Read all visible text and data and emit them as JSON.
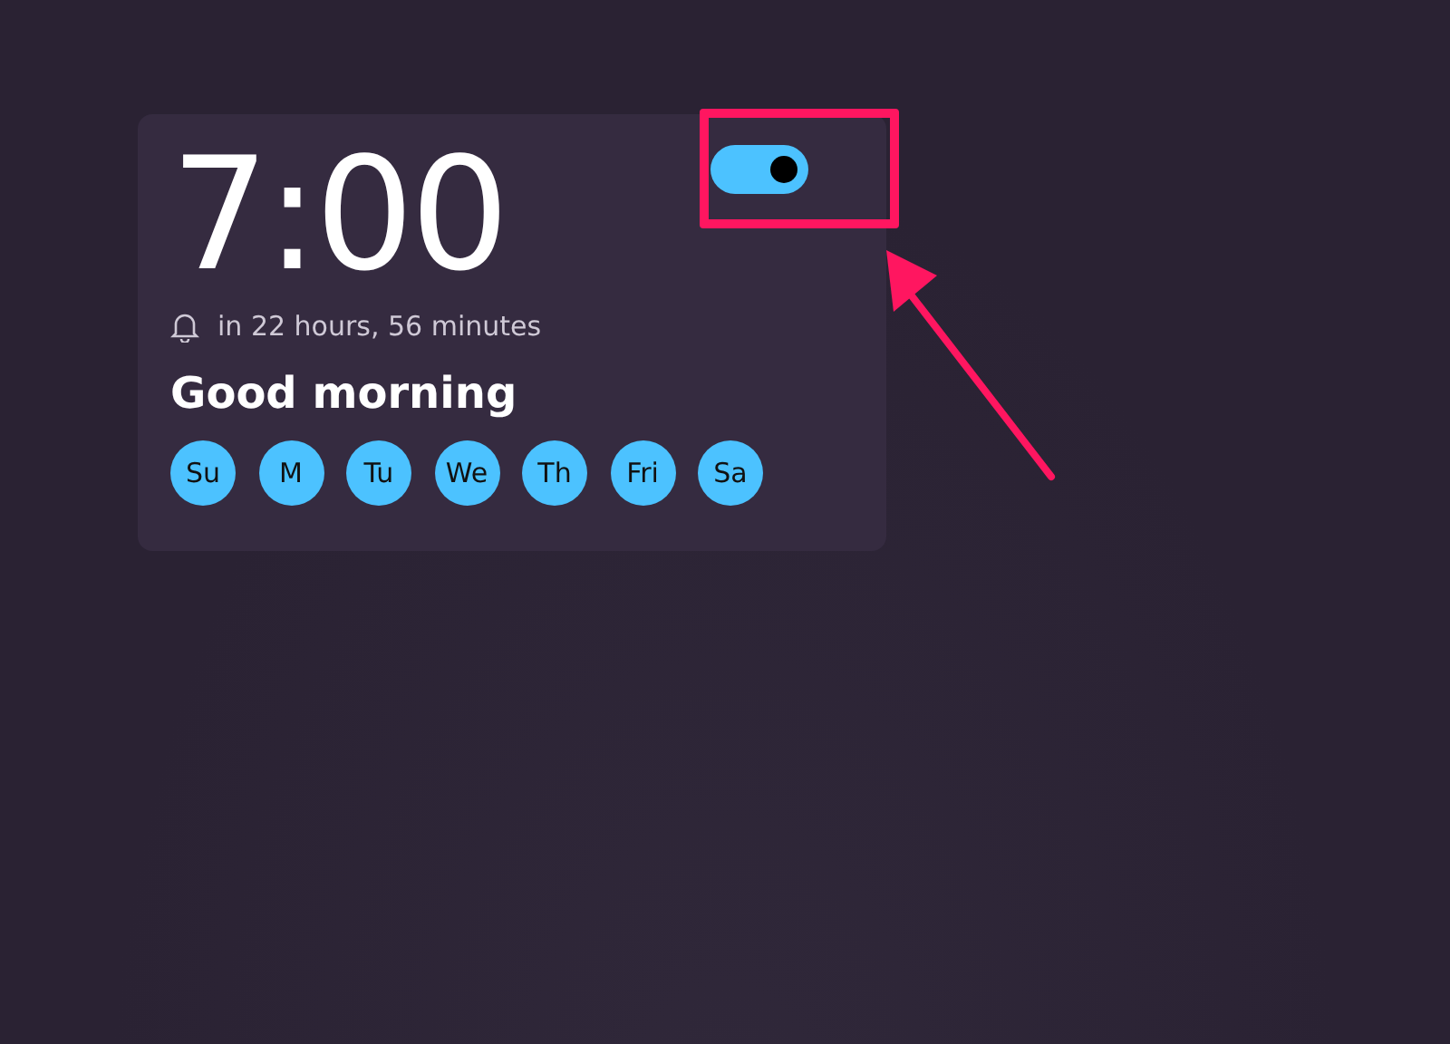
{
  "alarm": {
    "time": "7:00",
    "on": true,
    "countdown": "in 22 hours, 56 minutes",
    "name": "Good morning",
    "days": [
      {
        "label": "Su",
        "selected": true
      },
      {
        "label": "M",
        "selected": true
      },
      {
        "label": "Tu",
        "selected": true
      },
      {
        "label": "We",
        "selected": true
      },
      {
        "label": "Th",
        "selected": true
      },
      {
        "label": "Fri",
        "selected": true
      },
      {
        "label": "Sa",
        "selected": true
      }
    ]
  }
}
